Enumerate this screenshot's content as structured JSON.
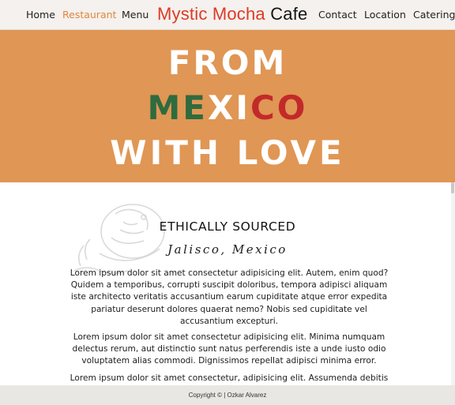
{
  "nav": {
    "links": [
      "Home",
      "Restaurant",
      "Menu",
      "Contact",
      "Location",
      "Catering"
    ],
    "active": "Restaurant",
    "brand_part1": "Mystic Mocha",
    "brand_part2": "Cafe"
  },
  "hero": {
    "line1": "FROM",
    "line2_part1": "ME",
    "line2_part2": "XI",
    "line2_part3": "CO",
    "line3": "WITH LOVE"
  },
  "section": {
    "emblem_icon": "mexican-eagle-emblem",
    "title": "ETHICALLY SOURCED",
    "subtitle": "Jalisco, Mexico",
    "paragraphs": [
      "Lorem ipsum dolor sit amet consectetur adipisicing elit. Autem, enim quod? Quidem a temporibus, corrupti suscipit doloribus, tempora adipisci aliquam iste architecto veritatis accusantium earum cupiditate atque error expedita pariatur deserunt dolores quaerat nemo? Nobis sed cupiditate vel accusantium excepturi.",
      "Lorem ipsum dolor sit amet consectetur adipisicing elit. Minima numquam delectus rerum, aut distinctio sunt natus perferendis iste a unde iusto odio voluptatem alias commodi. Dignissimos repellat adipisci minima error.",
      "Lorem ipsum dolor sit amet consectetur, adipisicing elit. Assumenda debitis"
    ]
  },
  "footer": {
    "text": "Copyright © | Ozkar Alvarez"
  },
  "colors": {
    "accent": "#e0873f",
    "hero_bg": "#e09654",
    "brand_red": "#de3a25",
    "flag_green": "#2f6b3f",
    "flag_red": "#c22a2a"
  }
}
